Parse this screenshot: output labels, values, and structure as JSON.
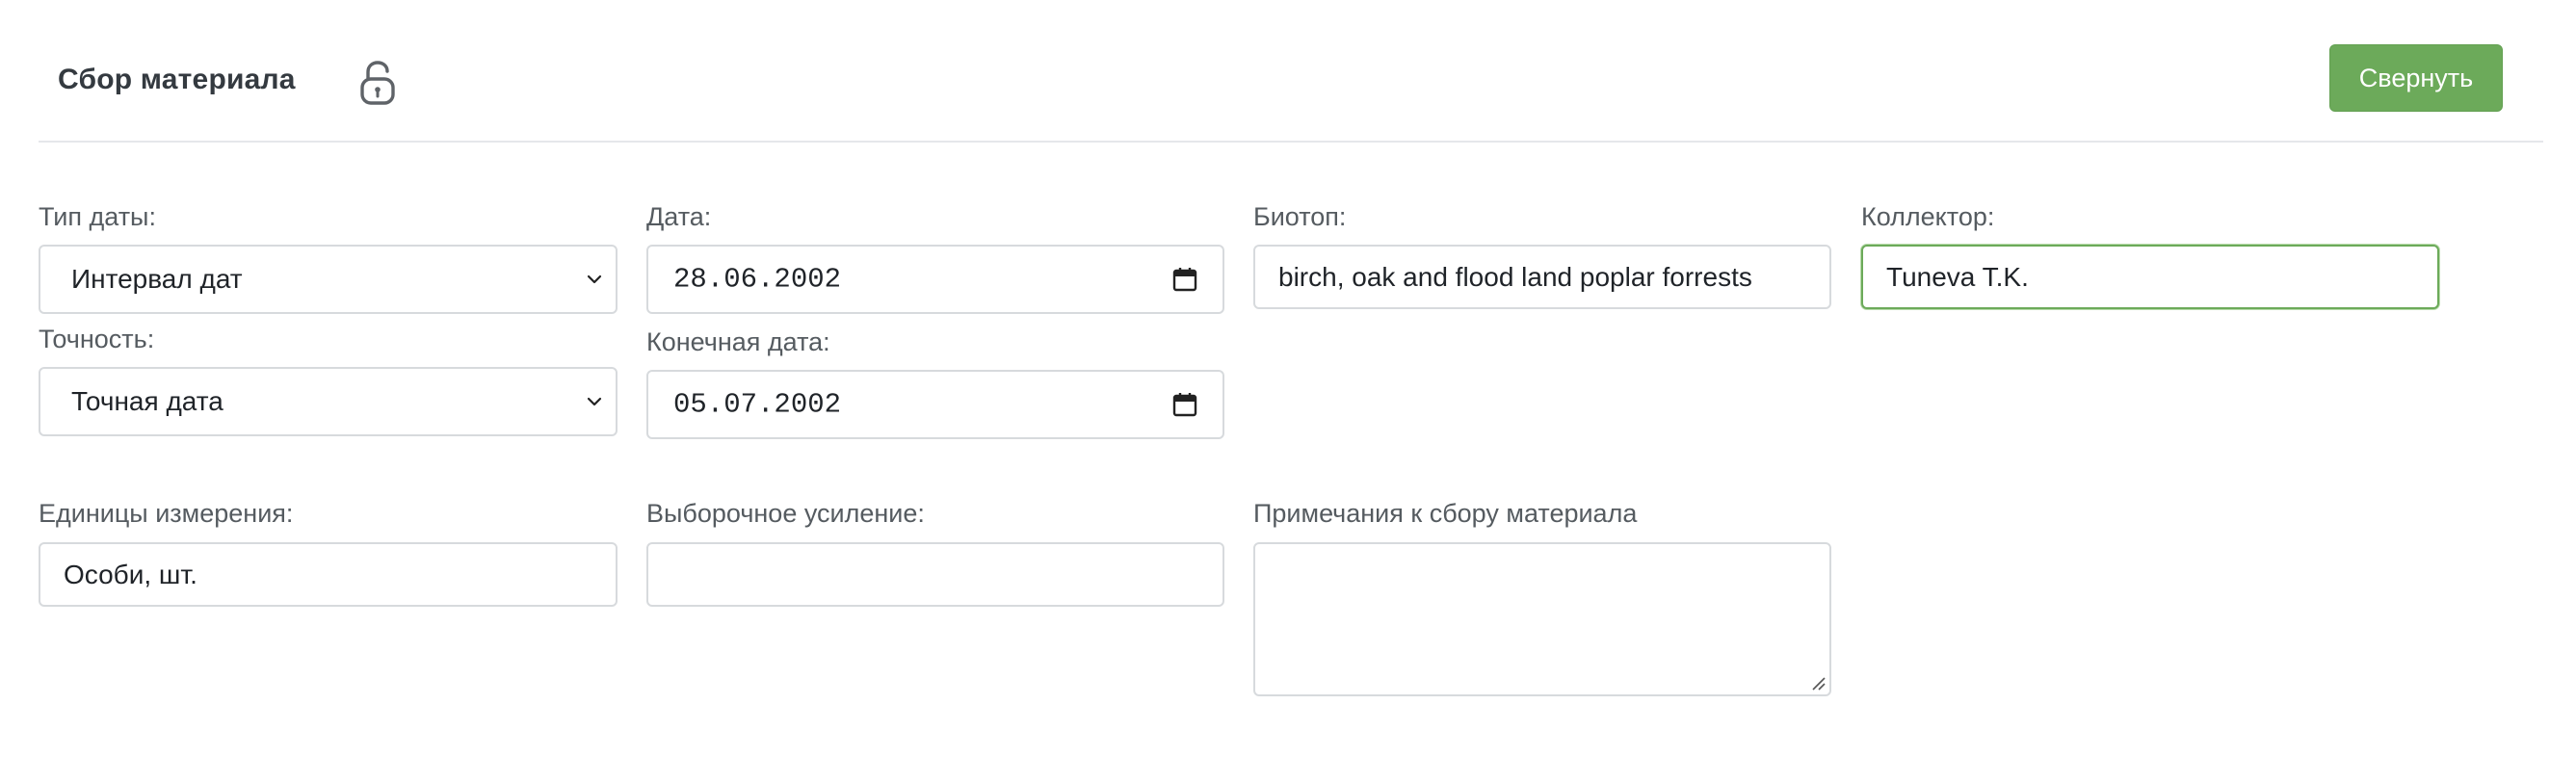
{
  "header": {
    "title": "Сбор материала",
    "lock_icon": "unlocked-padlock-icon",
    "collapse_label": "Свернуть",
    "accent": "#6caa5a"
  },
  "form": {
    "date_type": {
      "label": "Тип даты:",
      "value": "Интервал дат"
    },
    "precision": {
      "label": "Точность:",
      "value": "Точная дата"
    },
    "date": {
      "label": "Дата:",
      "value": "28.06.2002"
    },
    "end_date": {
      "label": "Конечная дата:",
      "value": "05.07.2002"
    },
    "biotope": {
      "label": "Биотоп:",
      "value": "birch, oak and flood land poplar forrests"
    },
    "collector": {
      "label": "Коллектор:",
      "value": "Tuneva T.K."
    },
    "units": {
      "label": "Единицы измерения:",
      "value": "Особи, шт."
    },
    "sampling_effort": {
      "label": "Выборочное усиление:",
      "value": ""
    },
    "notes": {
      "label": "Примечания к сбору материала",
      "value": ""
    }
  }
}
